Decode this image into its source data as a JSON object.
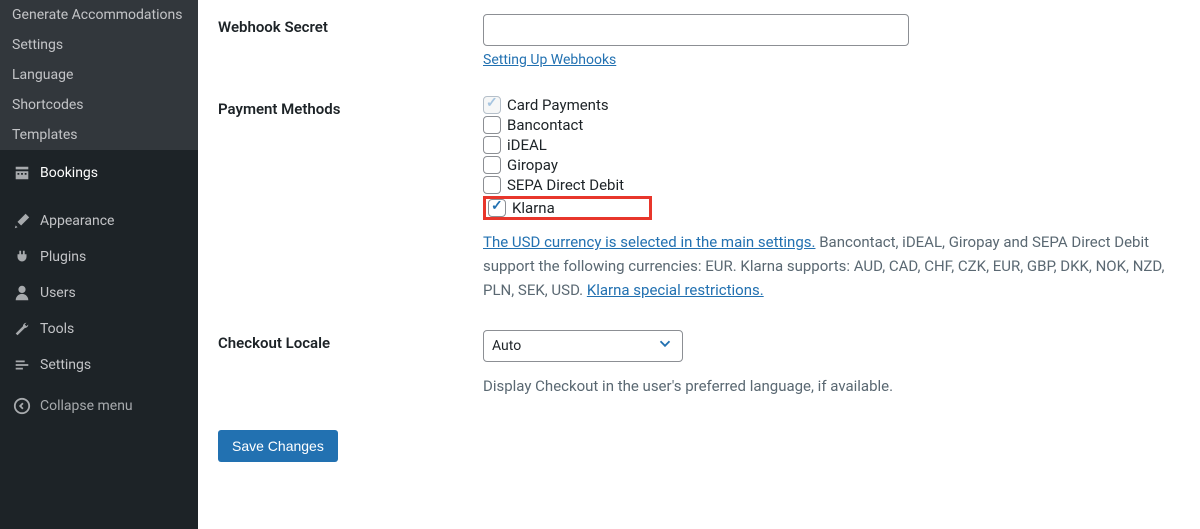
{
  "sidebar": {
    "sub_items": [
      {
        "label": "Generate Accommodations"
      },
      {
        "label": "Settings"
      },
      {
        "label": "Language"
      },
      {
        "label": "Shortcodes"
      },
      {
        "label": "Templates"
      }
    ],
    "bookings": {
      "label": "Bookings"
    },
    "main_items": [
      {
        "label": "Appearance",
        "icon": "brush"
      },
      {
        "label": "Plugins",
        "icon": "plug"
      },
      {
        "label": "Users",
        "icon": "user"
      },
      {
        "label": "Tools",
        "icon": "wrench"
      },
      {
        "label": "Settings",
        "icon": "sliders"
      }
    ],
    "collapse": {
      "label": "Collapse menu"
    }
  },
  "form": {
    "webhook_secret": {
      "label": "Webhook Secret",
      "value": "",
      "help_link": "Setting Up Webhooks"
    },
    "payment_methods": {
      "label": "Payment Methods",
      "options": [
        {
          "label": "Card Payments",
          "checked": true,
          "disabled": true
        },
        {
          "label": "Bancontact",
          "checked": false,
          "disabled": false
        },
        {
          "label": "iDEAL",
          "checked": false,
          "disabled": false
        },
        {
          "label": "Giropay",
          "checked": false,
          "disabled": false
        },
        {
          "label": "SEPA Direct Debit",
          "checked": false,
          "disabled": false
        },
        {
          "label": "Klarna",
          "checked": true,
          "disabled": false,
          "highlighted": true
        }
      ],
      "desc_link1": "The USD currency is selected in the main settings.",
      "desc_text": " Bancontact, iDEAL, Giropay and SEPA Direct Debit support the following currencies: EUR. Klarna supports: AUD, CAD, CHF, CZK, EUR, GBP, DKK, NOK, NZD, PLN, SEK, USD. ",
      "desc_link2": "Klarna special restrictions."
    },
    "checkout_locale": {
      "label": "Checkout Locale",
      "value": "Auto",
      "help": "Display Checkout in the user's preferred language, if available."
    },
    "save_label": "Save Changes"
  }
}
